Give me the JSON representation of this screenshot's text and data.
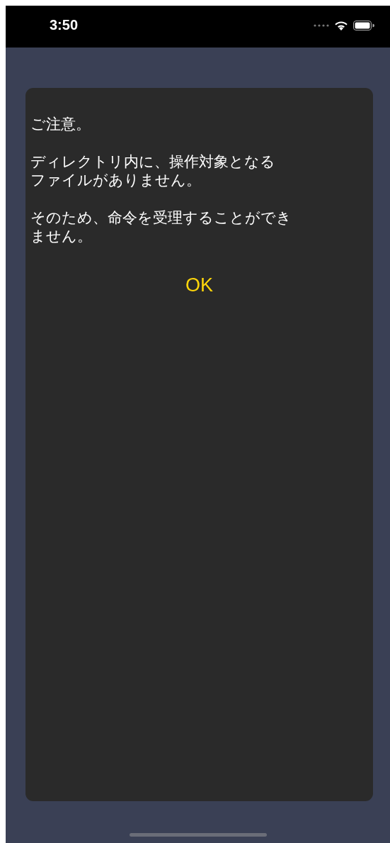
{
  "status_bar": {
    "time": "3:50"
  },
  "dialog": {
    "paragraphs": [
      "ご注意。",
      "ディレクトリ内に、操作対象となるファイルがありません。",
      "そのため、命令を受理することができません。"
    ],
    "button": "OK"
  }
}
